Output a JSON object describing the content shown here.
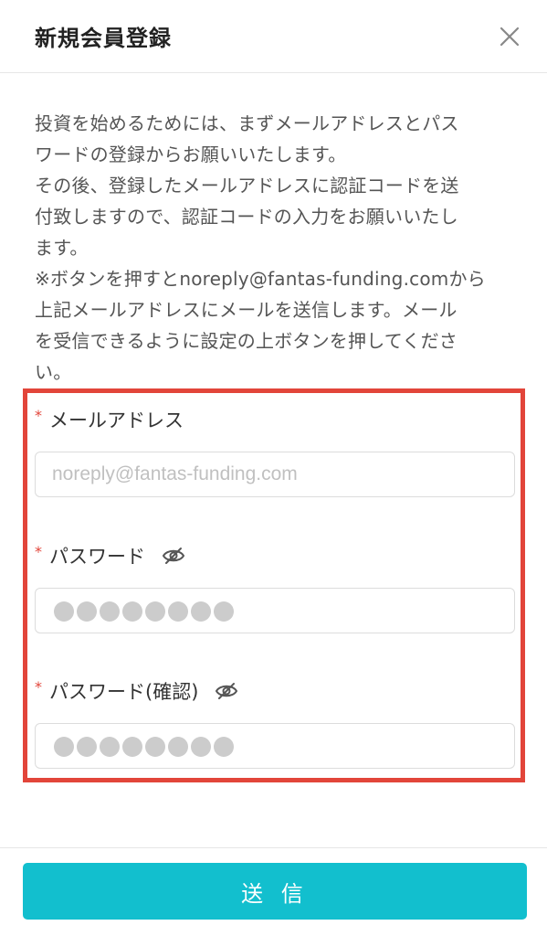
{
  "header": {
    "title": "新規会員登録",
    "close_icon": "close-icon"
  },
  "intro": {
    "text": "投資を始めるためには、まずメールアドレスとパス\nワードの登録からお願いいたします。\nその後、登録したメールアドレスに認証コードを送\n付致しますので、認証コードの入力をお願いいたし\nます。\n※ボタンを押すとnoreply@fantas-funding.comから\n上記メールアドレスにメールを送信します。メール\nを受信できるように設定の上ボタンを押してくださ\nい。"
  },
  "form": {
    "required_mark": "*",
    "email": {
      "label": "メールアドレス",
      "placeholder": "noreply@fantas-funding.com",
      "value": ""
    },
    "password": {
      "label": "パスワード",
      "toggle_icon": "eye-slash-icon",
      "masked_length": 8
    },
    "password_confirm": {
      "label": "パスワード(確認)",
      "toggle_icon": "eye-slash-icon",
      "masked_length": 8
    }
  },
  "footer": {
    "submit_label": "送 信"
  },
  "colors": {
    "accent": "#12bfce",
    "required": "#e2453a",
    "highlight_border": "#e2453a"
  }
}
